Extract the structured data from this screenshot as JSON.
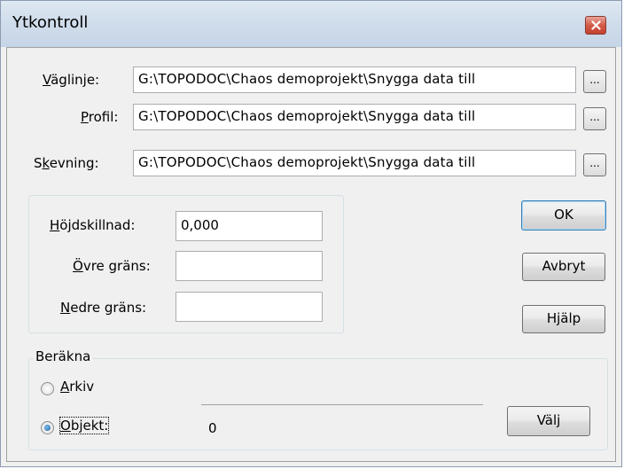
{
  "window": {
    "title": "Ytkontroll"
  },
  "files": {
    "vaglinje": {
      "label_pre": "",
      "label_u": "V",
      "label_post": "äglinje:",
      "value": "G:\\TOPODOC\\Chaos demoprojekt\\Snygga data till"
    },
    "profil": {
      "label_pre": "",
      "label_u": "P",
      "label_post": "rofil:",
      "value": "G:\\TOPODOC\\Chaos demoprojekt\\Snygga data till"
    },
    "skevning": {
      "label_pre": "S",
      "label_u": "k",
      "label_post": "evning:",
      "value": "G:\\TOPODOC\\Chaos demoprojekt\\Snygga data till"
    },
    "browse_label": "..."
  },
  "limits": {
    "hojdskillnad": {
      "label_u": "H",
      "label_post": "öjdskillnad:",
      "value": "0,000"
    },
    "ovre": {
      "label_u": "Ö",
      "label_post": "vre gräns:",
      "value": ""
    },
    "nedre": {
      "label_u": "N",
      "label_post": "edre gräns:",
      "value": ""
    }
  },
  "buttons": {
    "ok": "OK",
    "cancel": "Avbryt",
    "help": "Hjälp",
    "select": "Välj"
  },
  "calc": {
    "group_label": "Beräkna",
    "arkiv": {
      "label_u": "A",
      "label_post": "rkiv",
      "checked": false
    },
    "objekt": {
      "label_u": "O",
      "label_post": "bjekt:",
      "checked": true
    },
    "object_count": "0"
  }
}
